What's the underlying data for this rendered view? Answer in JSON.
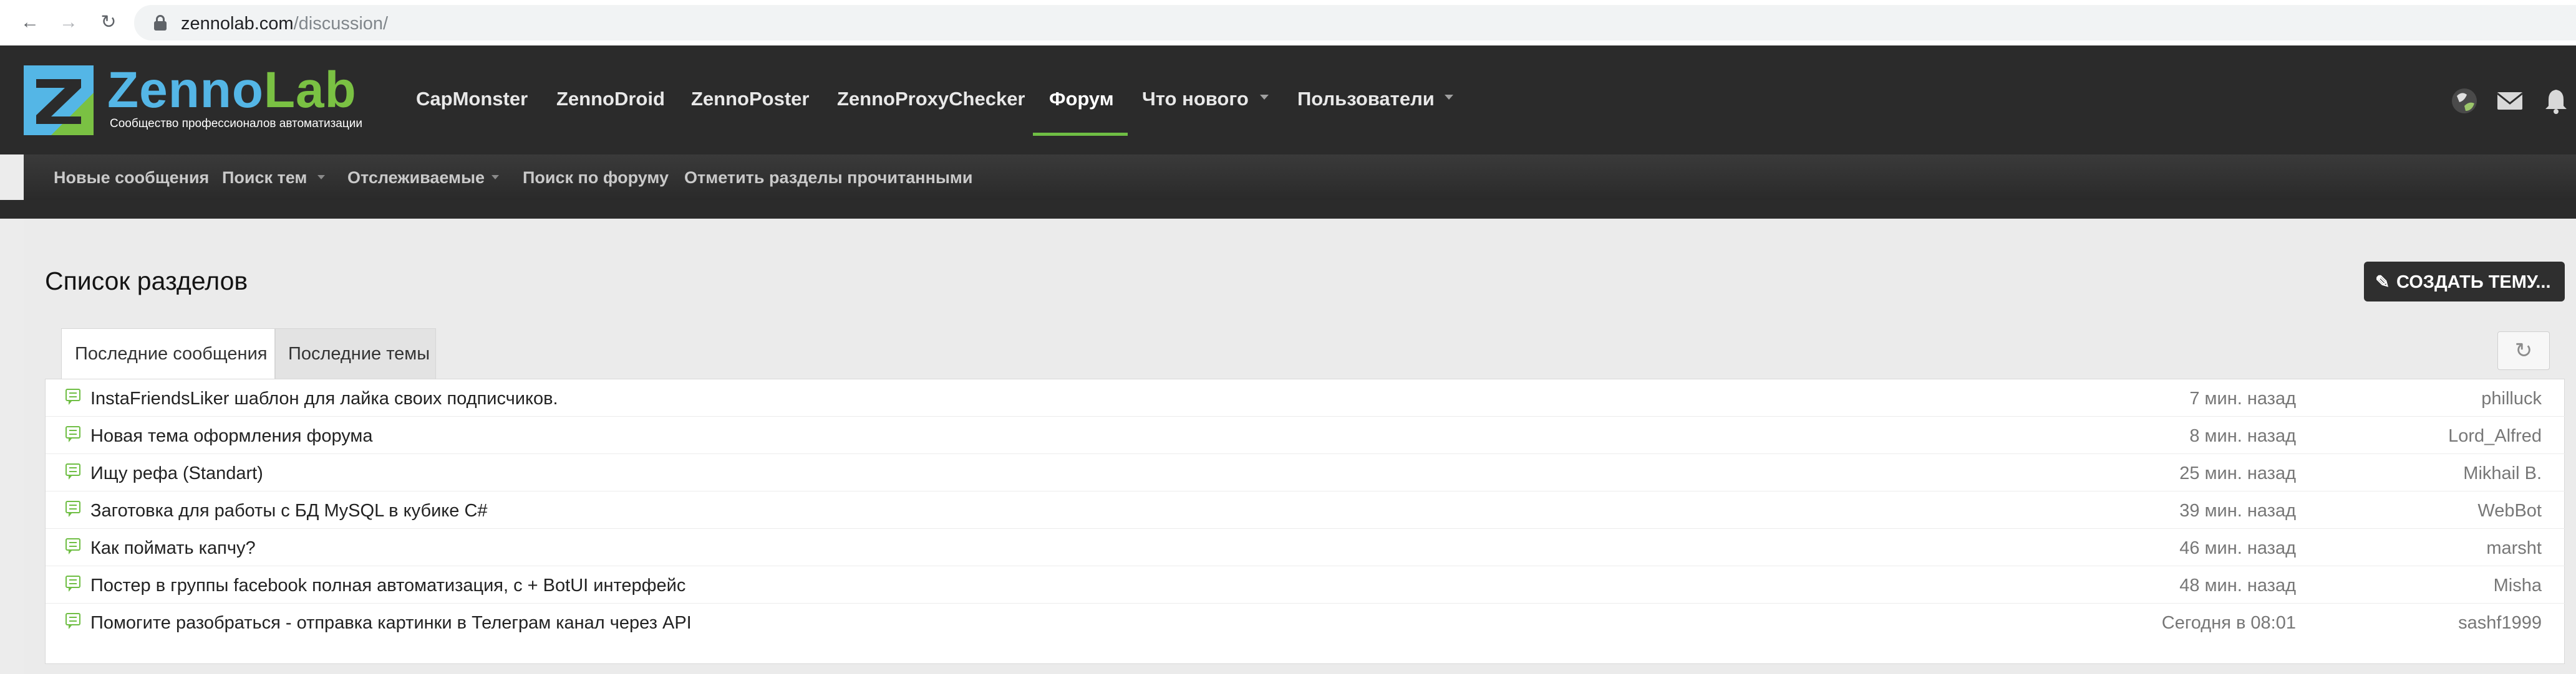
{
  "browser": {
    "url_host": "zennolab.com",
    "url_path": "/discussion/"
  },
  "header": {
    "logo_zenno": "Zenno",
    "logo_lab": "Lab",
    "tagline": "Сообщество профессионалов автоматизации",
    "nav": [
      {
        "label": "CapMonster"
      },
      {
        "label": "ZennoDroid"
      },
      {
        "label": "ZennoPoster"
      },
      {
        "label": "ZennoProxyChecker"
      },
      {
        "label": "Форум"
      },
      {
        "label": "Что нового"
      },
      {
        "label": "Пользователи"
      }
    ],
    "active_nav": "Форум"
  },
  "subnav": {
    "items": [
      {
        "label": "Новые сообщения"
      },
      {
        "label": "Поиск тем"
      },
      {
        "label": "Отслеживаемые"
      },
      {
        "label": "Поиск по форуму"
      },
      {
        "label": "Отметить разделы прочитанными"
      }
    ]
  },
  "main": {
    "title": "Список разделов",
    "create_button": "СОЗДАТЬ ТЕМУ...",
    "tabs": [
      {
        "label": "Последние сообщения"
      },
      {
        "label": "Последние темы"
      }
    ],
    "active_tab": "Последние сообщения",
    "rows": [
      {
        "title": "InstaFriendsLiker шаблон для лайка своих подписчиков.",
        "time": "7 мин. назад",
        "user": "philluck"
      },
      {
        "title": "Новая тема оформления форума",
        "time": "8 мин. назад",
        "user": "Lord_Alfred"
      },
      {
        "title": "Ищу рефа (Standart)",
        "time": "25 мин. назад",
        "user": "Mikhail B."
      },
      {
        "title": "Заготовка для работы с БД MySQL в кубике C#",
        "time": "39 мин. назад",
        "user": "WebBot"
      },
      {
        "title": "Как поймать капчу?",
        "time": "46 мин. назад",
        "user": "marsht"
      },
      {
        "title": "Постер в группы facebook полная автоматизация, с + BotUI интерфейс",
        "time": "48 мин. назад",
        "user": "Misha"
      },
      {
        "title": "Помогите разобраться - отправка картинки в Телеграм канал через API",
        "time": "Сегодня в 08:01",
        "user": "sashf1999"
      }
    ]
  },
  "colors": {
    "accent_green": "#6fbe44",
    "logo_blue": "#54b6e6",
    "header_bg": "#2b2b2b"
  }
}
